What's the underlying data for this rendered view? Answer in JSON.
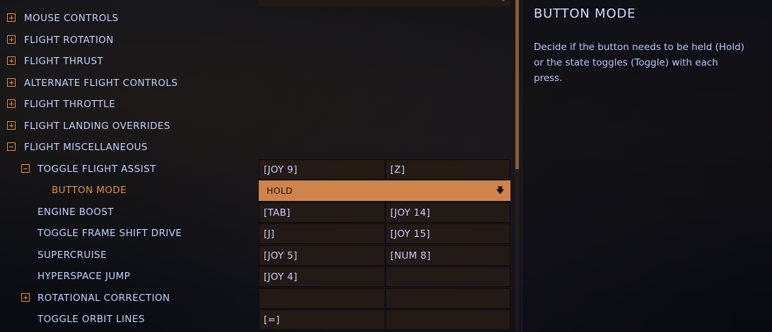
{
  "controls": {
    "rows": [
      {
        "label": "MOUSE CONTROLS",
        "expander": "plus"
      },
      {
        "label": "FLIGHT ROTATION",
        "expander": "plus"
      },
      {
        "label": "FLIGHT THRUST",
        "expander": "plus"
      },
      {
        "label": "ALTERNATE FLIGHT CONTROLS",
        "expander": "plus"
      },
      {
        "label": "FLIGHT THROTTLE",
        "expander": "plus"
      },
      {
        "label": "FLIGHT LANDING OVERRIDES",
        "expander": "plus"
      },
      {
        "label": "FLIGHT MISCELLANEOUS",
        "expander": "minus"
      },
      {
        "label": "TOGGLE FLIGHT ASSIST",
        "expander": "minus",
        "primary": "[JOY 9]",
        "secondary": "[Z]"
      },
      {
        "label": "BUTTON MODE",
        "value": "HOLD"
      },
      {
        "label": "ENGINE BOOST",
        "primary": "[TAB]",
        "secondary": "[JOY 14]"
      },
      {
        "label": "TOGGLE FRAME SHIFT DRIVE",
        "primary": "[J]",
        "secondary": "[JOY 15]"
      },
      {
        "label": "SUPERCRUISE",
        "primary": "[JOY 5]",
        "secondary": "[NUM 8]"
      },
      {
        "label": "HYPERSPACE JUMP",
        "primary": "[JOY 4]",
        "secondary": ""
      },
      {
        "label": "ROTATIONAL CORRECTION",
        "expander": "plus",
        "primary": "",
        "secondary": ""
      },
      {
        "label": "TOGGLE ORBIT LINES",
        "primary": "[=]",
        "secondary": ""
      }
    ]
  },
  "help": {
    "title": "BUTTON MODE",
    "body": "Decide if the button needs to be held (Hold) or the state toggles (Toggle) with each press."
  },
  "colors": {
    "accent": "#e08d4b",
    "text": "#c4cffe",
    "selected": "#d0834a"
  },
  "icons": {
    "expand": "plus-box-icon",
    "collapse": "minus-box-icon",
    "dropdown": "down-arrow-icon"
  }
}
